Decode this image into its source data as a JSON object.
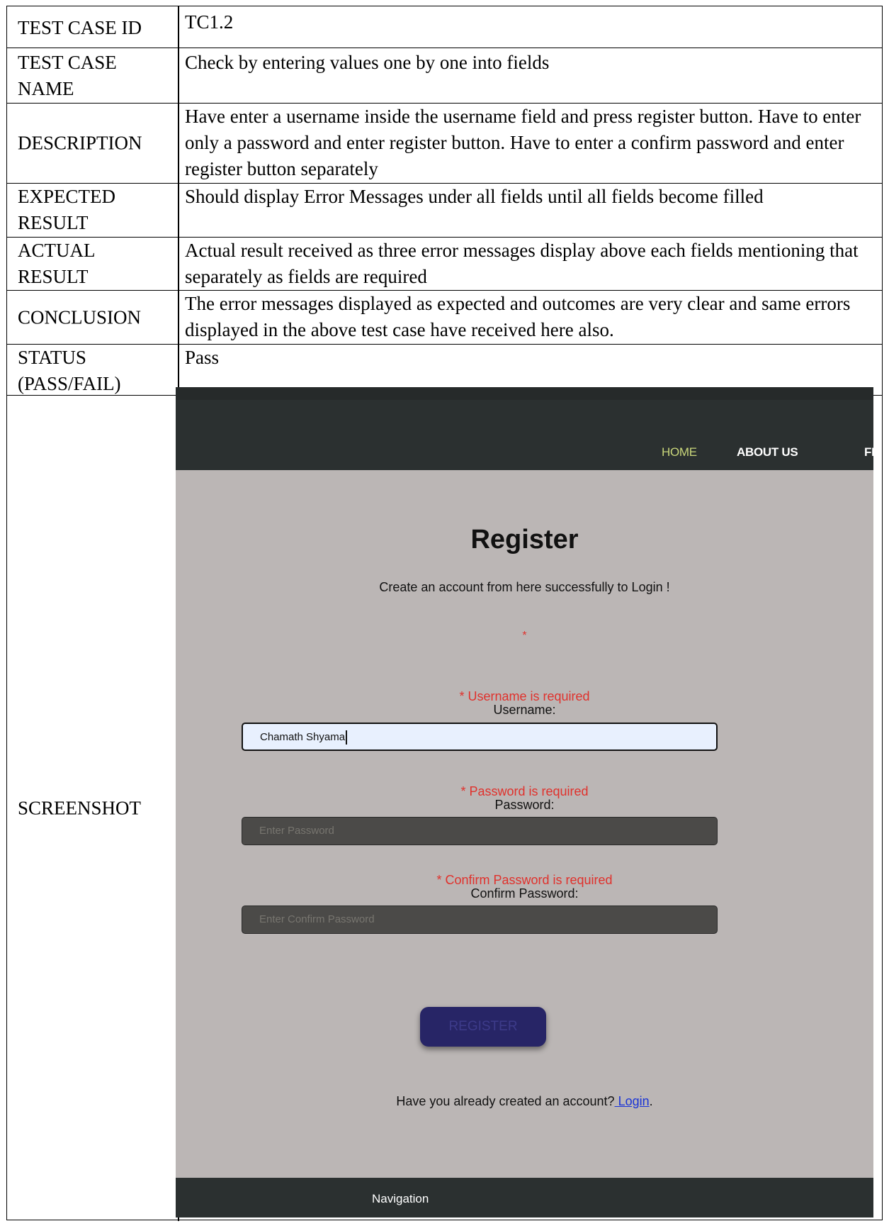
{
  "table": {
    "rows": [
      {
        "label": "TEST CASE ID",
        "value": "TC1.2"
      },
      {
        "label": "TEST CASE NAME",
        "value": "Check by entering values one by one into fields"
      },
      {
        "label": "DESCRIPTION",
        "value": "Have enter a username inside the username field and press register button. Have to enter only a password and enter register button. Have to enter a confirm password and enter register button separately"
      },
      {
        "label": "EXPECTED RESULT",
        "value": "Should display Error Messages under all fields until all fields become filled"
      },
      {
        "label": "ACTUAL RESULT",
        "value": "Actual result received as three error messages display above each fields mentioning that separately as fields are required"
      },
      {
        "label": "CONCLUSION",
        "value": "The error messages displayed as expected and outcomes are very clear and same errors displayed in the above test case have received here also."
      },
      {
        "label": "STATUS (PASS/FAIL)",
        "value": "Pass"
      },
      {
        "label": "SCREENSHOT",
        "value": ""
      }
    ]
  },
  "screenshot": {
    "nav": {
      "home": "HOME",
      "about": "ABOUT US",
      "third": "FIT"
    },
    "title": "Register",
    "subtitle": "Create an account from here successfully to Login !",
    "general_error": "*",
    "username": {
      "error": "* Username is required",
      "label": "Username:",
      "value": "Chamath Shyama"
    },
    "password": {
      "error": "* Password is required",
      "label": "Password:",
      "placeholder": "Enter Password"
    },
    "confirm": {
      "error": "* Confirm Password is required",
      "label": "Confirm Password:",
      "placeholder": "Enter Confirm Password"
    },
    "register_button": "REGISTER",
    "already_text": "Have you already created an account?",
    "login_link": " Login",
    "period": ".",
    "footer_nav": "Navigation"
  }
}
